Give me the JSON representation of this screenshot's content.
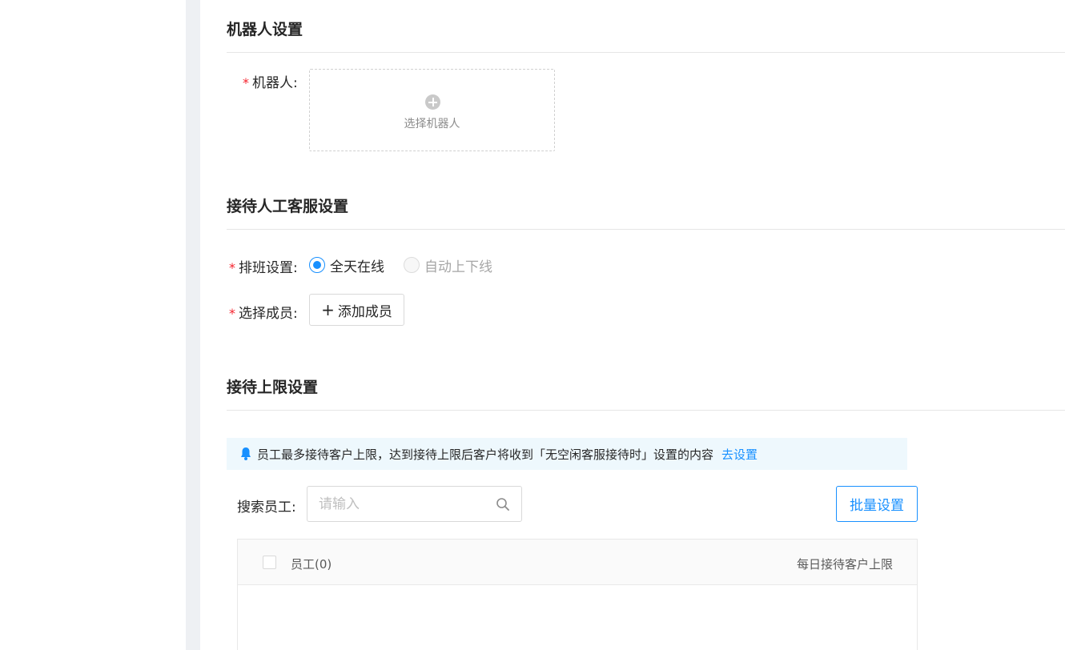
{
  "robot_section": {
    "title": "机器人设置",
    "robot_label": "机器人:",
    "required_mark": "*",
    "picker_label": "选择机器人"
  },
  "human_section": {
    "title": "接待人工客服设置",
    "schedule_label": "排班设置:",
    "schedule_options": [
      {
        "label": "全天在线",
        "checked": true,
        "disabled": false
      },
      {
        "label": "自动上下线",
        "checked": false,
        "disabled": true
      }
    ],
    "members_label": "选择成员:",
    "add_member_button": "添加成员",
    "required_mark": "*"
  },
  "limit_section": {
    "title": "接待上限设置",
    "notice_text": "员工最多接待客户上限，达到接待上限后客户将收到「无空闲客服接待时」设置的内容",
    "notice_link": "去设置",
    "search_label": "搜索员工:",
    "search_placeholder": "请输入",
    "search_value": "",
    "batch_button": "批量设置",
    "table": {
      "col_staff": "员工(0)",
      "col_limit": "每日接待客户上限"
    }
  },
  "colors": {
    "primary": "#1890ff",
    "required": "#f5222d",
    "notice_bg": "#eef8fd"
  }
}
